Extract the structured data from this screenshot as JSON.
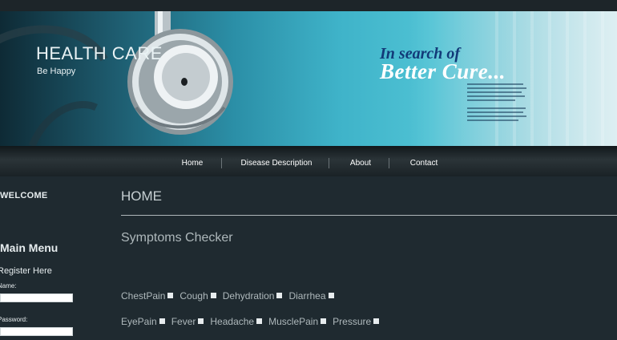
{
  "header": {
    "site_title": "HEALTH CARE",
    "tagline": "Be Happy",
    "headline_line1": "In search of",
    "headline_line2": "Better Cure..."
  },
  "nav": {
    "items": [
      {
        "label": "Home"
      },
      {
        "label": "Disease Description"
      },
      {
        "label": "About"
      },
      {
        "label": "Contact"
      }
    ]
  },
  "sidebar": {
    "welcome": "WELCOME",
    "menu_title": "Main Menu",
    "register_link": "Register Here",
    "username_label": "Name:",
    "password_label": "Password:",
    "username_value": "",
    "password_value": ""
  },
  "main": {
    "page_heading": "HOME",
    "section_title": "Symptoms Checker",
    "symptom_rows": [
      [
        "ChestPain",
        "Cough",
        "Dehydration",
        "Diarrhea"
      ],
      [
        "EyePain",
        "Fever",
        "Headache",
        "MusclePain",
        "Pressure"
      ]
    ]
  },
  "colors": {
    "page_background": "#1f2a30",
    "banner_accent": "#3fb3c9",
    "headline_blue": "#123a78"
  }
}
